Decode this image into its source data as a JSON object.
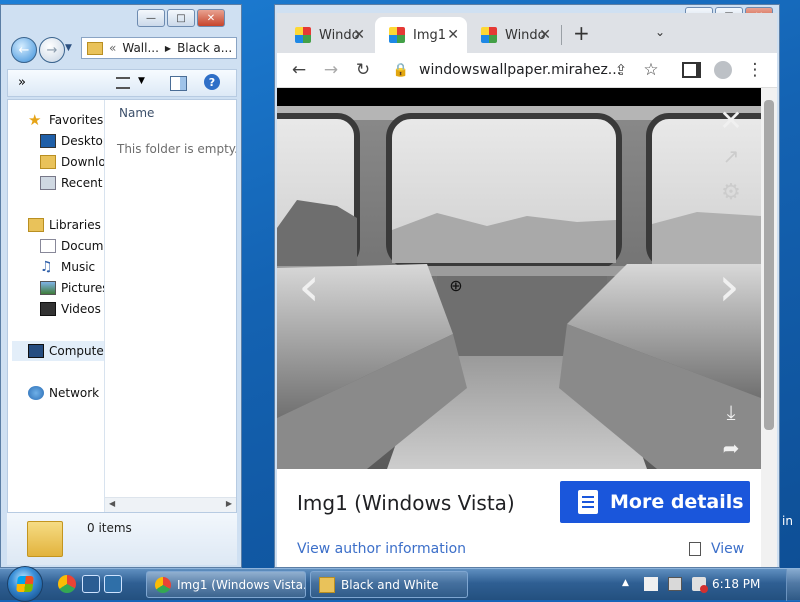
{
  "explorer": {
    "nav": {
      "back_label": "←",
      "forward_label": "→",
      "breadcrumb": [
        "Wall...",
        "Black a..."
      ]
    },
    "toolbar": {
      "more_label": "»"
    },
    "navpane": {
      "favorites": "Favorites",
      "desktop": "Desktop",
      "downloads": "Downlo",
      "recent": "Recent I",
      "libraries": "Libraries",
      "documents": "Docume",
      "music": "Music",
      "pictures": "Pictures",
      "videos": "Videos",
      "computer": "Compute",
      "network": "Network"
    },
    "content": {
      "column_name": "Name",
      "empty_text": "This folder is empty."
    },
    "details": {
      "item_count": "0 items"
    }
  },
  "chrome": {
    "tabs": [
      {
        "label": "Windo",
        "active": false
      },
      {
        "label": "Img1",
        "active": true
      },
      {
        "label": "Windo",
        "active": false
      }
    ],
    "new_tab_label": "+",
    "omnibox": {
      "url": "windowswallpaper.mirahez..."
    },
    "viewer": {
      "close_label": "✕",
      "prev_label": "‹",
      "next_label": "›"
    },
    "info": {
      "title": "Img1 (Windows Vista)",
      "more_details": "More details",
      "author_link": "View author information",
      "view_link": "View"
    }
  },
  "taskbar": {
    "buttons": [
      {
        "label": "Img1 (Windows Vista..."
      },
      {
        "label": "Black and White"
      }
    ],
    "clock": "6:18 PM"
  }
}
